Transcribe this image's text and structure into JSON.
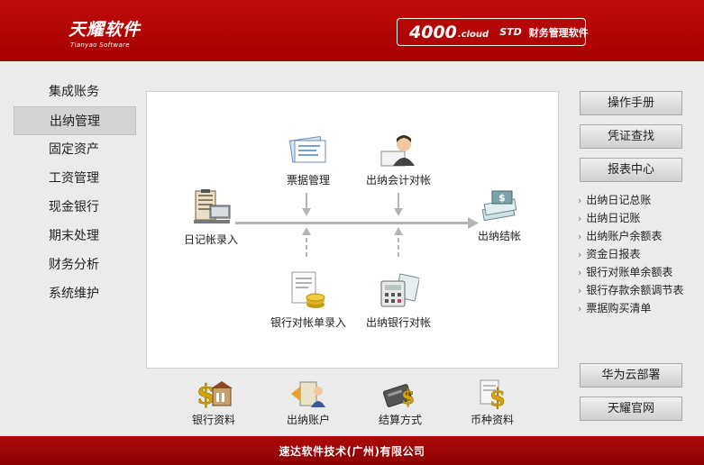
{
  "header": {
    "logo_cn": "天耀软件",
    "logo_en": "Tianyao Software",
    "version": "4000",
    "cloud": ".cloud",
    "edition": "STD",
    "product_name": "财务管理软件"
  },
  "nav": {
    "items": [
      {
        "label": "集成账务",
        "active": false
      },
      {
        "label": "出纳管理",
        "active": true
      },
      {
        "label": "固定资产",
        "active": false
      },
      {
        "label": "工资管理",
        "active": false
      },
      {
        "label": "现金银行",
        "active": false
      },
      {
        "label": "期末处理",
        "active": false
      },
      {
        "label": "财务分析",
        "active": false
      },
      {
        "label": "系统维护",
        "active": false
      }
    ]
  },
  "flow": {
    "journal_entry": "日记帐录入",
    "bill_mgmt": "票据管理",
    "cashier_acct_reconcile": "出纳会计对帐",
    "cashier_close": "出纳结帐",
    "bank_statement_entry": "银行对帐单录入",
    "cashier_bank_reconcile": "出纳银行对帐"
  },
  "quick_links": {
    "bank_info": "银行资料",
    "cashier_account": "出纳账户",
    "settlement": "结算方式",
    "currency": "币种资料"
  },
  "right": {
    "manual": "操作手册",
    "voucher_query": "凭证查找",
    "report_center": "报表中心",
    "reports": [
      "出纳日记总账",
      "出纳日记账",
      "出纳账户余额表",
      "资金日报表",
      "银行对账单余额表",
      "银行存款余额调节表",
      "票据购买清单"
    ],
    "huawei": "华为云部署",
    "website": "天耀官网"
  },
  "footer": {
    "company": "速达软件技术(广州)有限公司"
  },
  "colors": {
    "brand_red": "#b00000",
    "panel_bg": "#ffffff",
    "page_bg": "#ebebeb"
  }
}
